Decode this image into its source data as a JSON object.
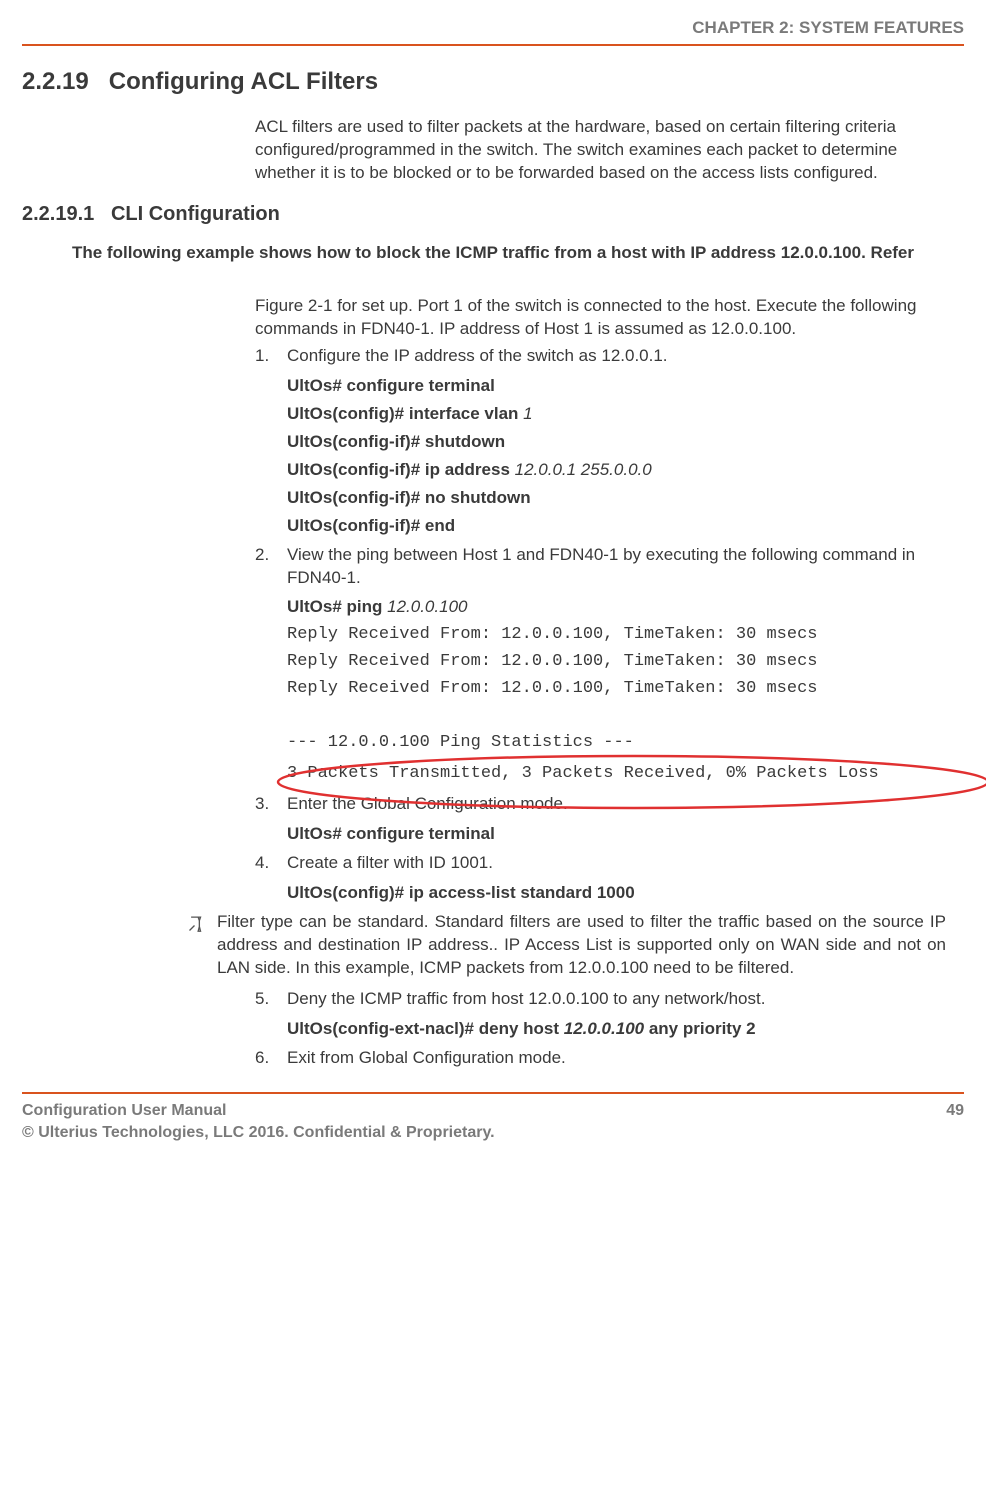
{
  "header": {
    "chapter": "CHAPTER 2: SYSTEM FEATURES"
  },
  "section": {
    "number": "2.2.19",
    "title": "Configuring ACL Filters",
    "intro": "ACL filters are used to filter packets at the hardware, based on certain filtering criteria configured/programmed in the switch. The switch examines each packet to determine whether it is to be blocked or to be forwarded based on the access lists configured."
  },
  "subsection": {
    "number": "2.2.19.1",
    "title": "CLI Configuration"
  },
  "example_lead": "The following example shows how to block the ICMP traffic from a host with IP address 12.0.0.100. Refer",
  "setup_para": "Figure 2-1 for set up. Port 1 of the switch is connected to the host. Execute the following commands in FDN40-1. IP address of Host 1 is assumed as 12.0.0.100.",
  "steps": {
    "s1": {
      "num": "1.",
      "text": "Configure the IP address of the switch as 12.0.0.1."
    },
    "s2": {
      "num": "2.",
      "text": "View the ping between Host 1 and FDN40-1 by executing the following command in FDN40-1."
    },
    "s3": {
      "num": "3.",
      "text": "Enter the Global Configuration mode."
    },
    "s4": {
      "num": "4.",
      "text": "Create a filter with ID 1001."
    },
    "s5": {
      "num": "5.",
      "text": "Deny the ICMP traffic from host 12.0.0.100 to any network/host."
    },
    "s6": {
      "num": "6.",
      "text": "Exit from Global Configuration mode."
    }
  },
  "cmds": {
    "c1": "UltOs# configure terminal",
    "c2a": "UltOs(config)# interface vlan ",
    "c2b": "1",
    "c3": "UltOs(config-if)# shutdown",
    "c4a": "UltOs(config-if)# ip address ",
    "c4b": "12.0.0.1  255.0.0.0",
    "c5": "UltOs(config-if)# no shutdown",
    "c6": "UltOs(config-if)# end",
    "c7a": "UltOs# ping ",
    "c7b": "12.0.0.100",
    "c8": "UltOs# configure terminal",
    "c9": "UltOs(config)# ip access-list standard 1000",
    "c10a": "UltOs(config-ext-nacl)# deny host ",
    "c10b": "12.0.0.100",
    "c10c": " any priority 2"
  },
  "output": {
    "r1": "Reply Received From: 12.0.0.100, TimeTaken: 30 msecs",
    "r2": "Reply Received From: 12.0.0.100, TimeTaken: 30 msecs",
    "r3": "Reply Received From: 12.0.0.100, TimeTaken: 30 msecs",
    "blank": " ",
    "stats": "--- 12.0.0.100 Ping Statistics ---",
    "summary": "3 Packets Transmitted, 3 Packets Received, 0% Packets Loss"
  },
  "note": "Filter type can be standard. Standard filters are used to filter the traffic based on the source IP address and destination IP address.. IP Access List is supported only on WAN side and not on LAN side. In this example, ICMP packets from 12.0.0.100 need to be filtered.",
  "footer": {
    "line1": "Configuration User Manual",
    "line2": "© Ulterius Technologies, LLC 2016. Confidential & Proprietary.",
    "page": "49"
  }
}
